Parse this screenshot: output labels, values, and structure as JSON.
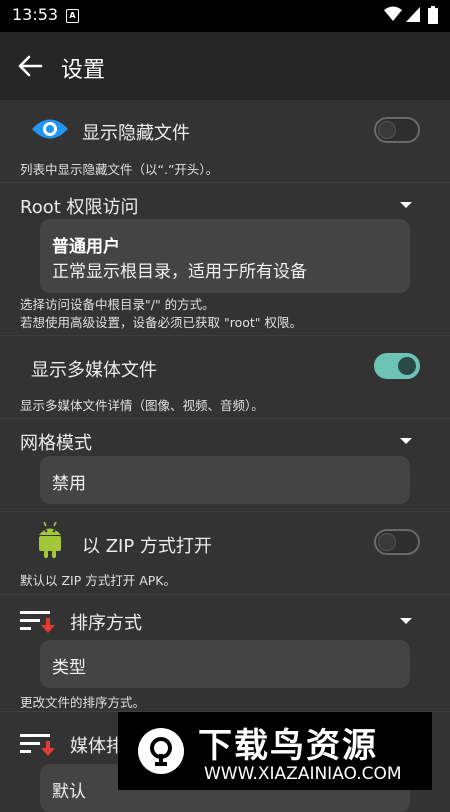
{
  "status_bar": {
    "time": "13:53",
    "notification_badge": "A"
  },
  "app_bar": {
    "title": "设置"
  },
  "settings": {
    "hidden_files": {
      "label": "显示隐藏文件",
      "description": "列表中显示隐藏文件（以“.”开头）。",
      "enabled": false
    },
    "root_access": {
      "label": "Root 权限访问",
      "selected_title": "普通用户",
      "selected_desc": "正常显示根目录，适用于所有设备",
      "description_line1": "选择访问设备中根目录\"/\" 的方式。",
      "description_line2": "若想使用高级设置，设备必须已获取 \"root\" 权限。"
    },
    "media_files": {
      "label": "显示多媒体文件",
      "description": "显示多媒体文件详情（图像、视频、音频）。",
      "enabled": true
    },
    "grid_mode": {
      "label": "网格模式",
      "selected": "禁用"
    },
    "zip_open": {
      "label": "以 ZIP 方式打开",
      "description": "默认以 ZIP 方式打开 APK。",
      "enabled": false
    },
    "sort_mode": {
      "label": "排序方式",
      "selected": "类型",
      "description": "更改文件的排序方式。"
    },
    "media_sort": {
      "label": "媒体排",
      "selected": "默认"
    }
  },
  "watermark": {
    "title": "下载鸟资源",
    "url": "WWW.XIAZAINIAO.COM"
  },
  "colors": {
    "accent": "#6cc5b4",
    "background": "#333333",
    "appbar": "#262626",
    "android_green": "#a4c639",
    "sort_red": "#e53935"
  },
  "icons": [
    "back-arrow-icon",
    "eye-icon",
    "android-icon",
    "sort-icon",
    "wifi-icon",
    "signal-icon",
    "battery-icon"
  ]
}
